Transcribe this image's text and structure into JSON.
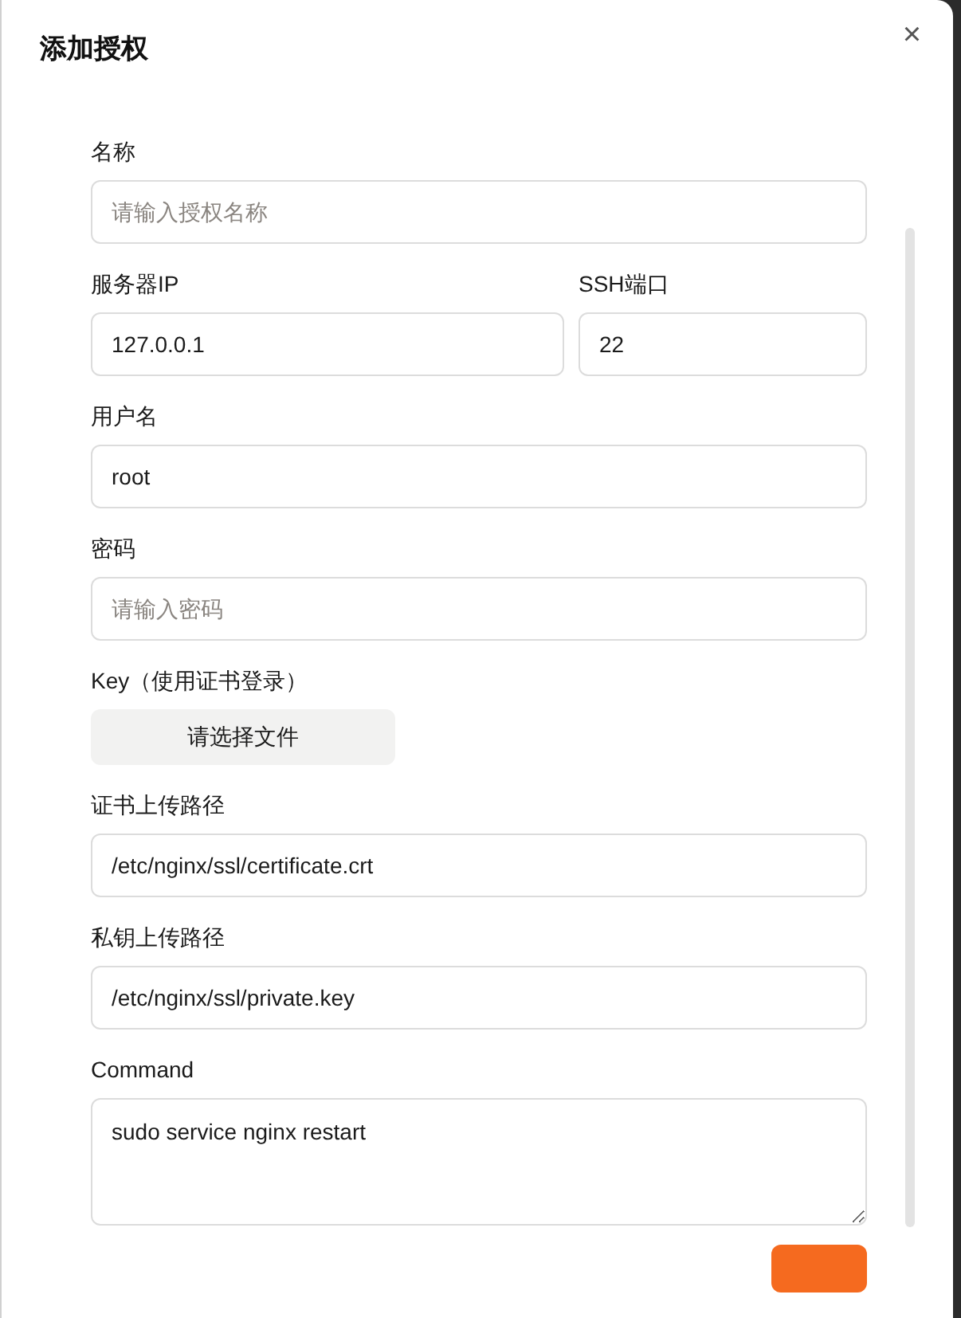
{
  "dialog": {
    "title": "添加授权",
    "close": "×"
  },
  "fields": [
    {
      "kind": "input",
      "label": "名称",
      "placeholder": "请输入授权名称"
    },
    {
      "kind": "row",
      "items": [
        {
          "label": "服务器IP",
          "value": "127.0.0.1"
        },
        {
          "label": "SSH端口",
          "value": "22"
        }
      ]
    },
    {
      "kind": "input",
      "label": "用户名",
      "value": "root"
    },
    {
      "kind": "input",
      "label": "密码",
      "placeholder": "请输入密码"
    },
    {
      "kind": "file",
      "label": "Key（使用证书登录）",
      "button": "请选择文件"
    },
    {
      "kind": "input",
      "label": "证书上传路径",
      "value": "/etc/nginx/ssl/certificate.crt"
    },
    {
      "kind": "input",
      "label": "私钥上传路径",
      "value": "/etc/nginx/ssl/private.key"
    },
    {
      "kind": "textarea",
      "label": "Command",
      "value": "sudo service nginx restart"
    }
  ]
}
